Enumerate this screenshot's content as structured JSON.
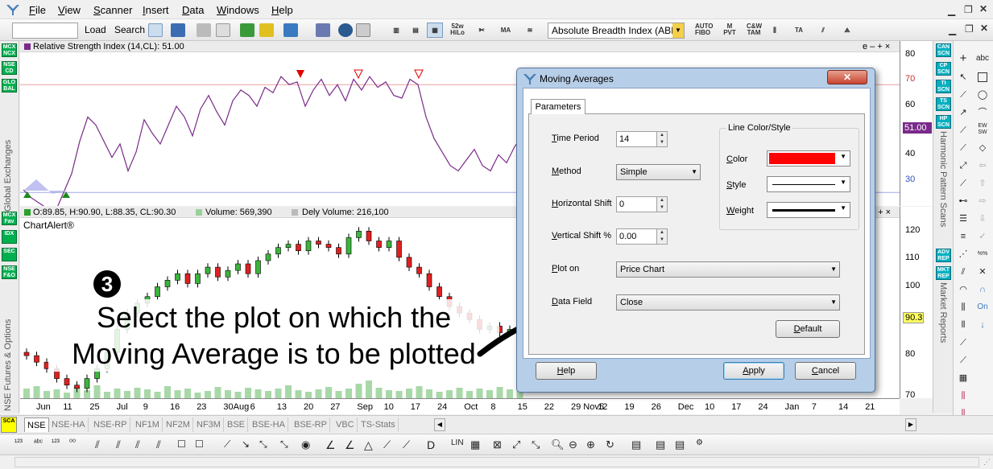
{
  "menu": {
    "items": [
      "File",
      "View",
      "Scanner",
      "Insert",
      "Data",
      "Windows",
      "Help"
    ]
  },
  "toolbar": {
    "load_label": "Load",
    "search_label": "Search",
    "indicator_select": "Absolute Breadth Index (ABI"
  },
  "left_panel": {
    "buttons": [
      "MCX NCX",
      "NSE CD",
      "GLO BAL",
      "MCX Fav",
      "IDX",
      "SEC",
      "NSE F&O"
    ],
    "label_top": "Global Exchanges",
    "label_bottom": "NSE Futures & Options"
  },
  "right_panel": {
    "buttons_top": [
      "CAN SCN",
      "CP SCN",
      "TI SCN",
      "TS SCN",
      "HP SCN"
    ],
    "label_top": "Harmonic Pattern Scans",
    "buttons_bottom": [
      "ADV REP",
      "MKT REP"
    ],
    "label_bottom": "Market Reports"
  },
  "rsi_pane": {
    "title": "Relative Strength Index (14,CL): 51.00",
    "controls": "e – + ×",
    "yticks": [
      "80",
      "70",
      "60",
      "50",
      "40",
      "30"
    ],
    "current_value": "51.00"
  },
  "price_pane": {
    "ohlc": "O:89.85, H:90.90, L:88.35, CL:90.30",
    "volume": "Volume: 569,390",
    "dely_volume": "Dely Volume: 216,100",
    "watermark": "ChartAlert®",
    "controls": "– + ×",
    "yticks": [
      "120",
      "110",
      "100",
      "90",
      "80",
      "70"
    ],
    "current_price": "90.3"
  },
  "xaxis": {
    "ticks": [
      "Jun",
      "11",
      "25",
      "Jul",
      "9",
      "16",
      "23",
      "30Aug",
      "6",
      "13",
      "20",
      "27",
      "Sep",
      "10",
      "17",
      "24",
      "Oct",
      "8",
      "15",
      "22",
      "29 Nov5",
      "12",
      "19",
      "26",
      "Dec",
      "10",
      "17",
      "24",
      "Jan",
      "7",
      "14",
      "21"
    ]
  },
  "exchange_tabs": [
    "NSE",
    "NSE-HA",
    "NSE-RP",
    "NF1M",
    "NF2M",
    "NF3M",
    "BSE",
    "BSE-HA",
    "BSE-RP",
    "VBC",
    "TS-Stats"
  ],
  "bottom_toolbar": {
    "lin_label": "LIN"
  },
  "dialog": {
    "title": "Moving Averages",
    "tab": "Parameters",
    "time_period_label": "Time Period",
    "time_period_value": "14",
    "method_label": "Method",
    "method_value": "Simple",
    "horizontal_shift_label": "Horizontal Shift",
    "horizontal_shift_value": "0",
    "vertical_shift_label": "Vertical Shift %",
    "vertical_shift_value": "0.00",
    "plot_on_label": "Plot on",
    "plot_on_value": "Price Chart",
    "data_field_label": "Data Field",
    "data_field_value": "Close",
    "group_title": "Line Color/Style",
    "color_label": "Color",
    "color_value": "#ff0000",
    "style_label": "Style",
    "weight_label": "Weight",
    "default_label": "Default",
    "help_label": "Help",
    "apply_label": "Apply",
    "cancel_label": "Cancel"
  },
  "annotation": {
    "step_number": "❸",
    "text_line1": "Select the plot on which the",
    "text_line2": "Moving Average is to be plotted"
  },
  "chart_data": {
    "rsi": {
      "type": "line",
      "ylim": [
        25,
        82
      ],
      "values": [
        31,
        28,
        26,
        24,
        23,
        30,
        37,
        49,
        58,
        55,
        49,
        43,
        48,
        38,
        45,
        57,
        52,
        48,
        55,
        62,
        58,
        51,
        61,
        66,
        60,
        55,
        64,
        68,
        66,
        62,
        69,
        67,
        73,
        70,
        71,
        62,
        68,
        72,
        66,
        70,
        64,
        72,
        68,
        73,
        69,
        71,
        66,
        65,
        72,
        70,
        58,
        50,
        45,
        40,
        38,
        42,
        46,
        40,
        38,
        44,
        41,
        47,
        51
      ]
    },
    "price": {
      "type": "candlestick",
      "ylim": [
        70,
        125
      ],
      "closes": [
        83,
        81,
        79,
        76,
        74,
        73,
        76,
        79,
        84,
        91,
        96,
        99,
        101,
        104,
        106,
        108,
        105,
        108,
        110,
        107,
        109,
        111,
        108,
        112,
        114,
        116,
        117,
        115,
        118,
        117,
        116,
        114,
        119,
        121,
        118,
        116,
        118,
        113,
        110,
        108,
        104,
        101,
        98,
        96,
        94,
        91,
        92,
        90,
        91,
        90.3
      ]
    },
    "volume": {
      "type": "bar",
      "values": [
        12,
        15,
        9,
        11,
        7,
        14,
        10,
        16,
        8,
        12,
        9,
        13,
        11,
        8,
        15,
        10,
        12,
        7,
        9,
        14,
        10,
        8,
        13,
        11,
        9,
        12,
        16,
        10,
        8,
        11,
        14,
        9,
        12,
        18,
        22,
        13,
        10,
        9,
        12,
        15,
        11,
        8,
        10,
        13,
        9,
        12,
        10,
        14,
        11,
        9
      ]
    }
  }
}
